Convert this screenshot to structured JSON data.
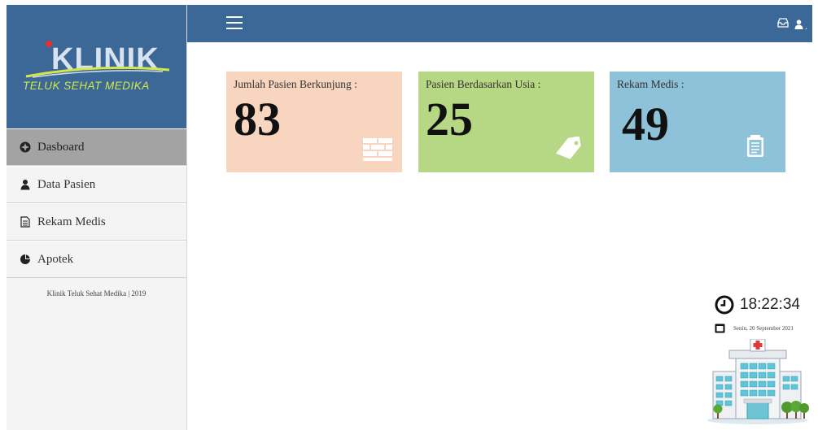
{
  "sidebar": {
    "logo_title": "KLINIK",
    "logo_subtitle": "TELUK SEHAT MEDIKA",
    "items": [
      {
        "label": "Dasboard",
        "icon": "compass-icon",
        "active": true
      },
      {
        "label": "Data Pasien",
        "icon": "user-icon",
        "active": false
      },
      {
        "label": "Rekam Medis",
        "icon": "document-icon",
        "active": false
      },
      {
        "label": "Apotek",
        "icon": "pie-chart-icon",
        "active": false
      }
    ],
    "footer": "Klinik Teluk Sehat Medika | 2019"
  },
  "topbar": {
    "menu_icon": "hamburger-icon",
    "right_icons": [
      "inbox-icon",
      "user-icon"
    ],
    "right_suffix": "."
  },
  "cards": [
    {
      "label": "Jumlah Pasien Berkunjung :",
      "value": "83",
      "color": "#f7d5bf",
      "icon": "brick-icon"
    },
    {
      "label": "Pasien Berdasarkan Usia :",
      "value": "25",
      "color": "#b6d885",
      "icon": "tag-icon"
    },
    {
      "label": "Rekam Medis :",
      "value": "49",
      "color": "#8ec2d9",
      "icon": "clipboard-icon"
    }
  ],
  "clock": {
    "time": "18:22:34",
    "date": "Senin, 20 September 2021",
    "clock_icon": "clock-icon",
    "calendar_icon": "calendar-icon",
    "illustration": "hospital-illustration"
  },
  "colors": {
    "primary": "#3b6896",
    "sidebar_bg": "#f4f4f4",
    "active_bg": "#a3a3a3",
    "logo_accent": "#d4e64a"
  }
}
